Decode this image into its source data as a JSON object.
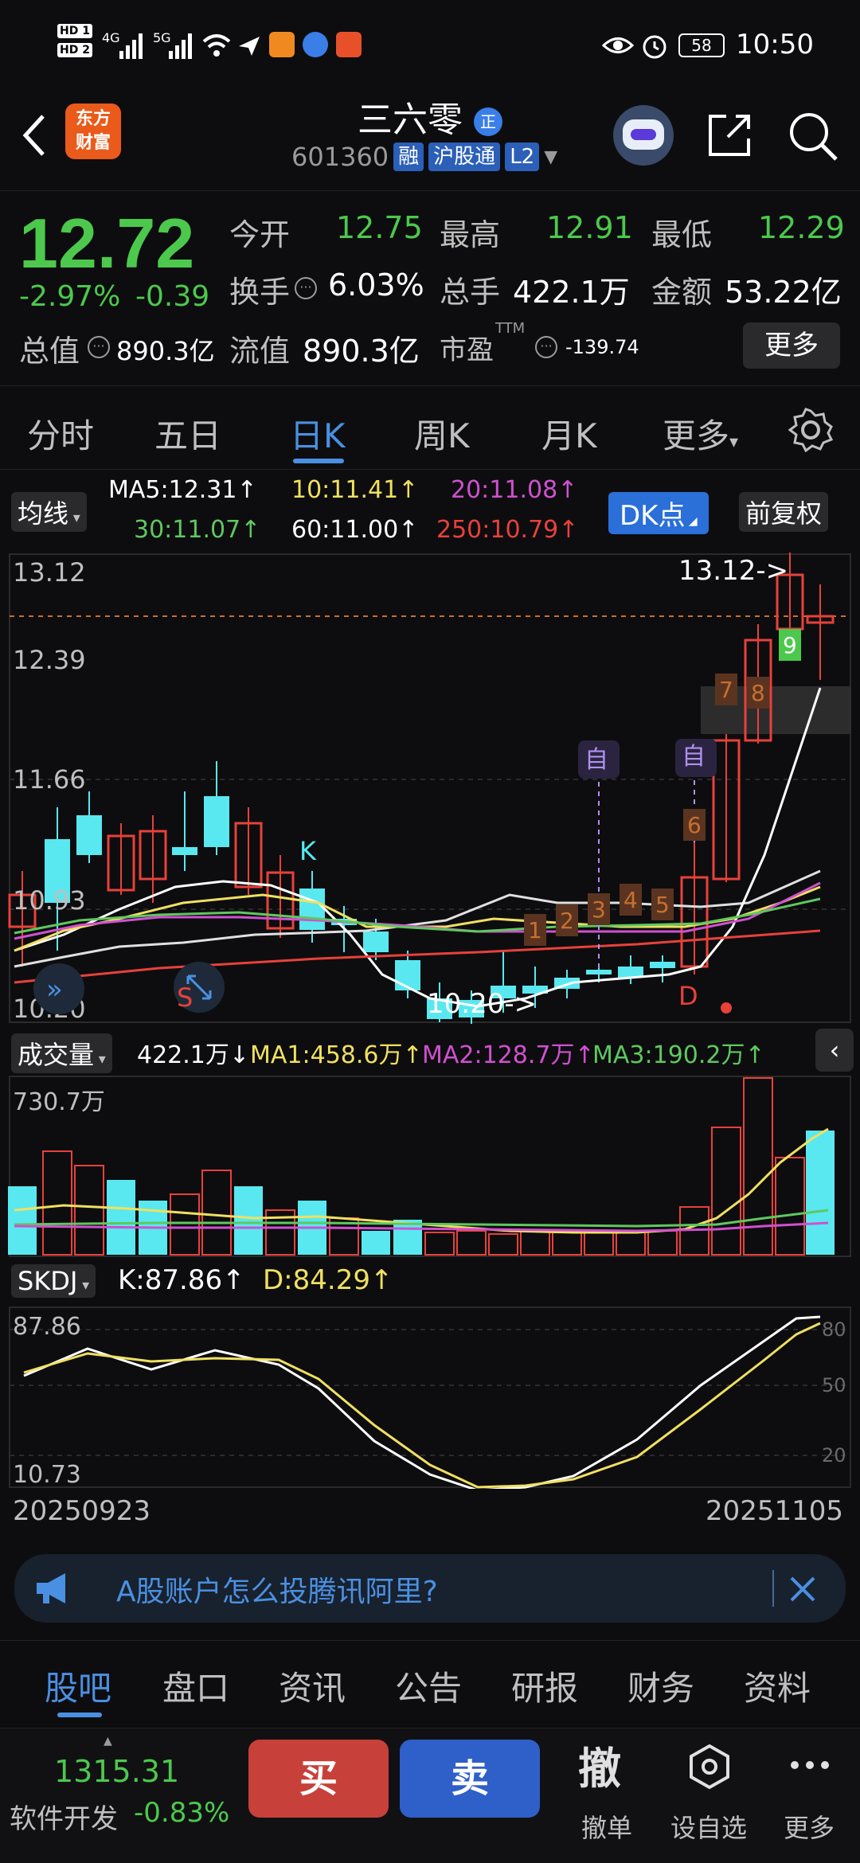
{
  "status_bar": {
    "hd1": "HD 1",
    "hd2": "HD 2",
    "net1": "4G",
    "net2": "5G",
    "battery": "58",
    "time": "10:50"
  },
  "header": {
    "logo_line1": "东方",
    "logo_line2": "财富",
    "stock_name": "三六零",
    "badge": "正",
    "stock_code": "601360",
    "tags": [
      "融",
      "沪股通",
      "L2"
    ]
  },
  "quote": {
    "price": "12.72",
    "change_pct": "-2.97%",
    "change": "-0.39",
    "open_label": "今开",
    "open": "12.75",
    "high_label": "最高",
    "high": "12.91",
    "low_label": "最低",
    "low": "12.29",
    "turnover_label": "换手",
    "turnover": "6.03%",
    "volume_label": "总手",
    "volume": "422.1万",
    "amount_label": "金额",
    "amount": "53.22亿",
    "mktcap_label": "总值",
    "mktcap": "890.3亿",
    "float_label": "流值",
    "float": "890.3亿",
    "pe_label": "市盈",
    "pe_sup": "TTM",
    "pe": "-139.74",
    "more": "更多"
  },
  "tabs": [
    "分时",
    "五日",
    "日K",
    "周K",
    "月K",
    "更多"
  ],
  "ma": {
    "chip": "均线",
    "ma5": "MA5:12.31↑",
    "ma10": "10:11.41↑",
    "ma20": "20:11.08↑",
    "ma30": "30:11.07↑",
    "ma60": "60:11.00↑",
    "ma250": "250:10.79↑",
    "dk": "DK点",
    "fq": "前复权"
  },
  "kline": {
    "y_top": "13.12",
    "y2": "12.39",
    "y3": "11.66",
    "y4": "10.93",
    "y_bottom": "10.20",
    "hi_marker": "13.12->",
    "lo_marker": "10.20->",
    "k_label": "K",
    "s_label": "S",
    "d_label": "D",
    "zi1": "自",
    "zi2": "自",
    "nums": [
      "1",
      "2",
      "3",
      "4",
      "5",
      "6",
      "7",
      "8",
      "9"
    ]
  },
  "volume": {
    "chip": "成交量",
    "value": "422.1万↓",
    "ma1": "MA1:458.6万↑",
    "ma2": "MA2:128.7万↑",
    "ma3": "MA3:190.2万↑",
    "y_top": "730.7万"
  },
  "skdj": {
    "chip": "SKDJ",
    "k": "K:87.86↑",
    "d": "D:84.29↑",
    "y_top": "87.86",
    "y_bottom": "10.73",
    "r80": "80",
    "r50": "50",
    "r20": "20",
    "date_start": "20250923",
    "date_end": "20251105"
  },
  "banner": {
    "text": "A股账户怎么投腾讯阿里?"
  },
  "bottom_tabs": [
    "股吧",
    "盘口",
    "资讯",
    "公告",
    "研报",
    "财务",
    "资料"
  ],
  "action_bar": {
    "index_value": "1315.31",
    "index_name": "软件开发",
    "index_change": "-0.83%",
    "buy": "买",
    "sell": "卖",
    "cancel_icon": "撤",
    "cancel_label": "撤单",
    "watch_label": "设自选",
    "more_label": "更多"
  },
  "colors": {
    "up": "#e8413a",
    "down": "#59e8f0",
    "green": "#4cc94c",
    "accent": "#4a90e2"
  }
}
